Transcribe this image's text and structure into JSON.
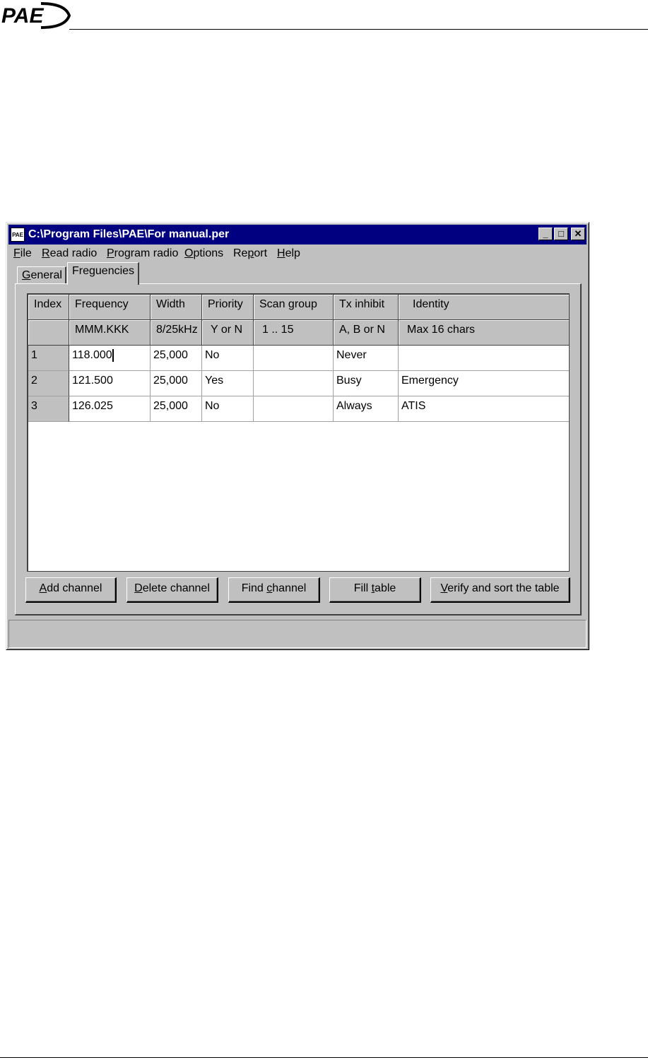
{
  "page": {
    "logo_text": "PAE"
  },
  "window": {
    "title": "C:\\Program Files\\PAE\\For manual.per",
    "app_icon_text": "PAE",
    "controls": {
      "minimize": "_",
      "maximize": "□",
      "close": "✕"
    }
  },
  "menu": [
    {
      "label": "File",
      "accel": "F",
      "rest": "ile"
    },
    {
      "label": "Read radio",
      "accel": "R",
      "rest": "ead radio"
    },
    {
      "label": "Program radio",
      "accel": "P",
      "rest": "rogram radio"
    },
    {
      "label": "Options",
      "accel": "O",
      "rest": "ptions"
    },
    {
      "label": "Report",
      "pre": "Re",
      "accel": "p",
      "rest": "ort"
    },
    {
      "label": "Help",
      "accel": "H",
      "rest": "elp"
    }
  ],
  "tabs": [
    {
      "label": "General",
      "accel": "G",
      "rest": "eneral",
      "active": false
    },
    {
      "label": "Freguencies",
      "active": true
    }
  ],
  "table": {
    "headers": [
      "Index",
      "Frequency",
      "Width",
      "Priority",
      "Scan group",
      "Tx inhibit",
      "Identity"
    ],
    "formats": [
      "",
      "MMM.KKK",
      "8/25kHz",
      "Y or N",
      "1 .. 15",
      "A, B or N",
      "Max 16 chars"
    ],
    "rows": [
      [
        "1",
        "118.000",
        "25,000",
        "No",
        "",
        "Never",
        ""
      ],
      [
        "2",
        "121.500",
        "25,000",
        "Yes",
        "",
        "Busy",
        "Emergency"
      ],
      [
        "3",
        "126.025",
        "25,000",
        "No",
        "",
        "Always",
        "ATIS"
      ]
    ]
  },
  "buttons": [
    {
      "label": "Add channel",
      "accel": "A",
      "rest": "dd channel"
    },
    {
      "label": "Delete channel",
      "accel": "D",
      "rest": "elete channel"
    },
    {
      "label": "Find channel",
      "pre": "Find ",
      "accel": "c",
      "rest": "hannel"
    },
    {
      "label": "Fill table",
      "pre": "Fill ",
      "accel": "t",
      "rest": "able"
    },
    {
      "label": "Verify and sort the table",
      "accel": "V",
      "rest": "erify and sort the table"
    }
  ],
  "status": {
    "text": ""
  }
}
